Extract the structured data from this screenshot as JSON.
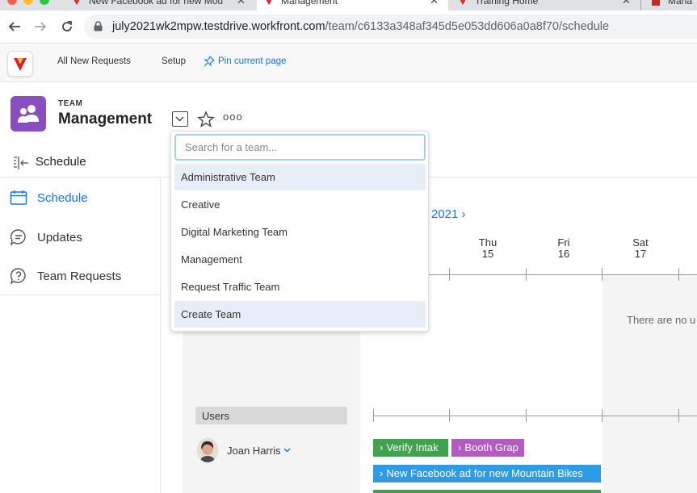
{
  "browser": {
    "tabs": [
      {
        "title": "New Facebook ad for new Mou",
        "close": "✕"
      },
      {
        "title": "Management",
        "close": "✕"
      },
      {
        "title": "Training Home",
        "close": "✕"
      },
      {
        "title": "Mana"
      }
    ],
    "url_host": "july2021wk2mpw.testdrive.workfront.com",
    "url_path": "/team/c6133a348af345d5e053dd606a0a8f70/schedule"
  },
  "topnav": {
    "all_new_requests": "All New Requests",
    "setup": "Setup",
    "pin_page": "Pin current page"
  },
  "header": {
    "kicker": "TEAM",
    "title": "Management",
    "more": "ooo"
  },
  "subbar": {
    "label": "Schedule"
  },
  "leftnav": {
    "items": [
      {
        "label": "Schedule",
        "icon": "calendar-icon",
        "active": true
      },
      {
        "label": "Updates",
        "icon": "speech-bubble-icon"
      },
      {
        "label": "Team Requests",
        "icon": "question-bubble-icon"
      }
    ]
  },
  "dropdown": {
    "placeholder": "Search for a team...",
    "items": [
      "Administrative Team",
      "Creative",
      "Digital Marketing Team",
      "Management",
      "Request Traffic Team",
      "Create Team"
    ]
  },
  "schedule": {
    "month_label": "2021 ›",
    "days": [
      {
        "dow": "Thu",
        "date": "15"
      },
      {
        "dow": "Fri",
        "date": "16"
      },
      {
        "dow": "Sat",
        "date": "17"
      }
    ],
    "empty_message": "There are no u",
    "users_heading": "Users",
    "user_name": "Joan Harris",
    "tasks": [
      {
        "label": "Verify Intak",
        "color": "#3fa34d"
      },
      {
        "label": "Booth Grap",
        "color": "#b35bc1"
      },
      {
        "label": "New Facebook ad for new Mountain Bikes",
        "color": "#2d9be6"
      }
    ]
  },
  "colors": {
    "accent": "#1473e6",
    "team_avatar": "#8a4dbf",
    "task_green": "#3fa34d",
    "task_purple": "#b35bc1",
    "task_blue": "#2d9be6"
  }
}
